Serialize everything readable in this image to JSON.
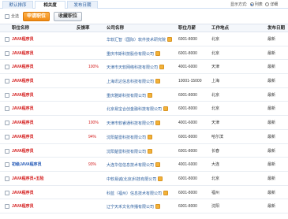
{
  "tabs": [
    {
      "label": "默认排序",
      "active": false
    },
    {
      "label": "相关度",
      "active": true
    },
    {
      "label": "发布日期",
      "active": false
    }
  ],
  "display_mode": {
    "label": "显示方式:",
    "options": [
      "列表",
      "详细"
    ],
    "selected": "列表"
  },
  "toolbar": {
    "select_all": "全选",
    "apply_label": "申请职位",
    "favorite_label": "收藏职位"
  },
  "columns": [
    "职位名称",
    "反馈率",
    "公司名称",
    "职位月薪",
    "工作地点",
    "发布日期"
  ],
  "rows": [
    {
      "job": "JAVA程序员",
      "score": "",
      "company": "华软汇智（国际）软件技术研究院",
      "salary": "6001-8000",
      "location": "北京",
      "date": "最新"
    },
    {
      "job": "JAVA程序员",
      "score": "",
      "company": "重庆市斯科技股份有限公司",
      "salary": "6001-8000",
      "location": "北京",
      "date": "最新"
    },
    {
      "job": "JAVA程序员",
      "score": "100%",
      "company": "天津市天软网络科技有限公司",
      "salary": "4001-6000",
      "location": "天津",
      "date": "最新"
    },
    {
      "job": "JAVA程序员",
      "score": "",
      "company": "上海讯达信息科技有限公司",
      "salary": "10001-15000",
      "location": "上海",
      "date": "最新"
    },
    {
      "job": "JAVA程序员",
      "score": "",
      "company": "重庆雅斯科技有限公司",
      "salary": "6001-8000",
      "location": "北京",
      "date": "最新"
    },
    {
      "job": "JAVA程序员",
      "score": "",
      "company": "北京易宝合创金融科技有限公司",
      "salary": "6001-8000",
      "location": "北京",
      "date": "最新"
    },
    {
      "job": "JAVA程序员",
      "score": "100%",
      "company": "天津市软睿通科技有限公司",
      "salary": "4001-6000",
      "location": "天津",
      "date": "最新"
    },
    {
      "job": "JAVA程序员",
      "score": "94%",
      "company": "沈阳楚雷科技有限公司",
      "salary": "6001-8000",
      "location": "哈尔滨",
      "date": "最新"
    },
    {
      "job": "JAVA程序员",
      "score": "",
      "company": "沈阳楚雷科技有限公司",
      "salary": "6001-8000",
      "location": "长春",
      "date": "最新"
    },
    {
      "job": "初级JAVA程序员",
      "score": "93%",
      "company": "大连华信信息技术有限公司",
      "salary": "4001-6000",
      "location": "大连",
      "date": "最新",
      "blue": true
    },
    {
      "job": "JAVA程序员+五险",
      "score": "",
      "company": "中软易诚(北京)科技有限公司",
      "salary": "6001-8000",
      "location": "北京",
      "date": "最新"
    },
    {
      "job": "JAVA程序员",
      "score": "",
      "company": "科蓝（福州）信息技术有限公司",
      "salary": "6001-8000",
      "location": "福州",
      "date": "最新"
    },
    {
      "job": "JAVA程序员",
      "score": "",
      "company": "辽宁天禾文化传播有限公司",
      "salary": "6001-8000",
      "location": "沈阳",
      "date": "最新"
    }
  ],
  "colors": {
    "accent": "#f08a14",
    "link": "#2b5e9e",
    "job": "#d31b1b"
  }
}
